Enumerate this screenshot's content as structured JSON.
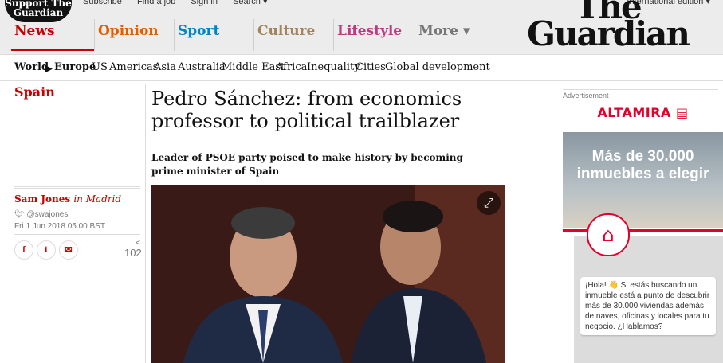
{
  "header": {
    "support_line1": "Support The",
    "support_line2": "Guardian",
    "links": [
      "Subscribe",
      "Find a job",
      "Sign in",
      "Search ▾"
    ],
    "edition": "International edition ▾",
    "logo_line1": "The",
    "logo_line2": "Guardian",
    "pillars": [
      {
        "label": "News",
        "color": "#c70000"
      },
      {
        "label": "Opinion",
        "color": "#e05e00"
      },
      {
        "label": "Sport",
        "color": "#0084c6"
      },
      {
        "label": "Culture",
        "color": "#a1845c"
      },
      {
        "label": "Lifestyle",
        "color": "#bb3b80"
      },
      {
        "label": "More ▾",
        "color": "#767676"
      }
    ]
  },
  "subnav": {
    "items": [
      "World",
      "Europe",
      "US",
      "Americas",
      "Asia",
      "Australia",
      "Middle East",
      "Africa",
      "Inequality",
      "Cities",
      "Global development"
    ]
  },
  "article": {
    "section": "Spain",
    "author": "Sam Jones",
    "location": "in Madrid",
    "twitter": "@swajones",
    "date": "Fri 1 Jun 2018 05.00 BST",
    "share_count": "102",
    "headline": "Pedro Sánchez: from economics professor to political trailblazer",
    "standfirst": "Leader of PSOE party poised to make history by becoming prime minister of Spain"
  },
  "ad": {
    "label": "Advertisement",
    "brand": "ALTAMIRA",
    "headline": "Más de 30.000 inmuebles a elegir",
    "chat": "¡Hola! 👋 Si estás buscando un inmueble está a punto de descubrir más de 30.000 viviendas además de naves, oficinas y locales para tu negocio. ¿Hablamos?"
  }
}
